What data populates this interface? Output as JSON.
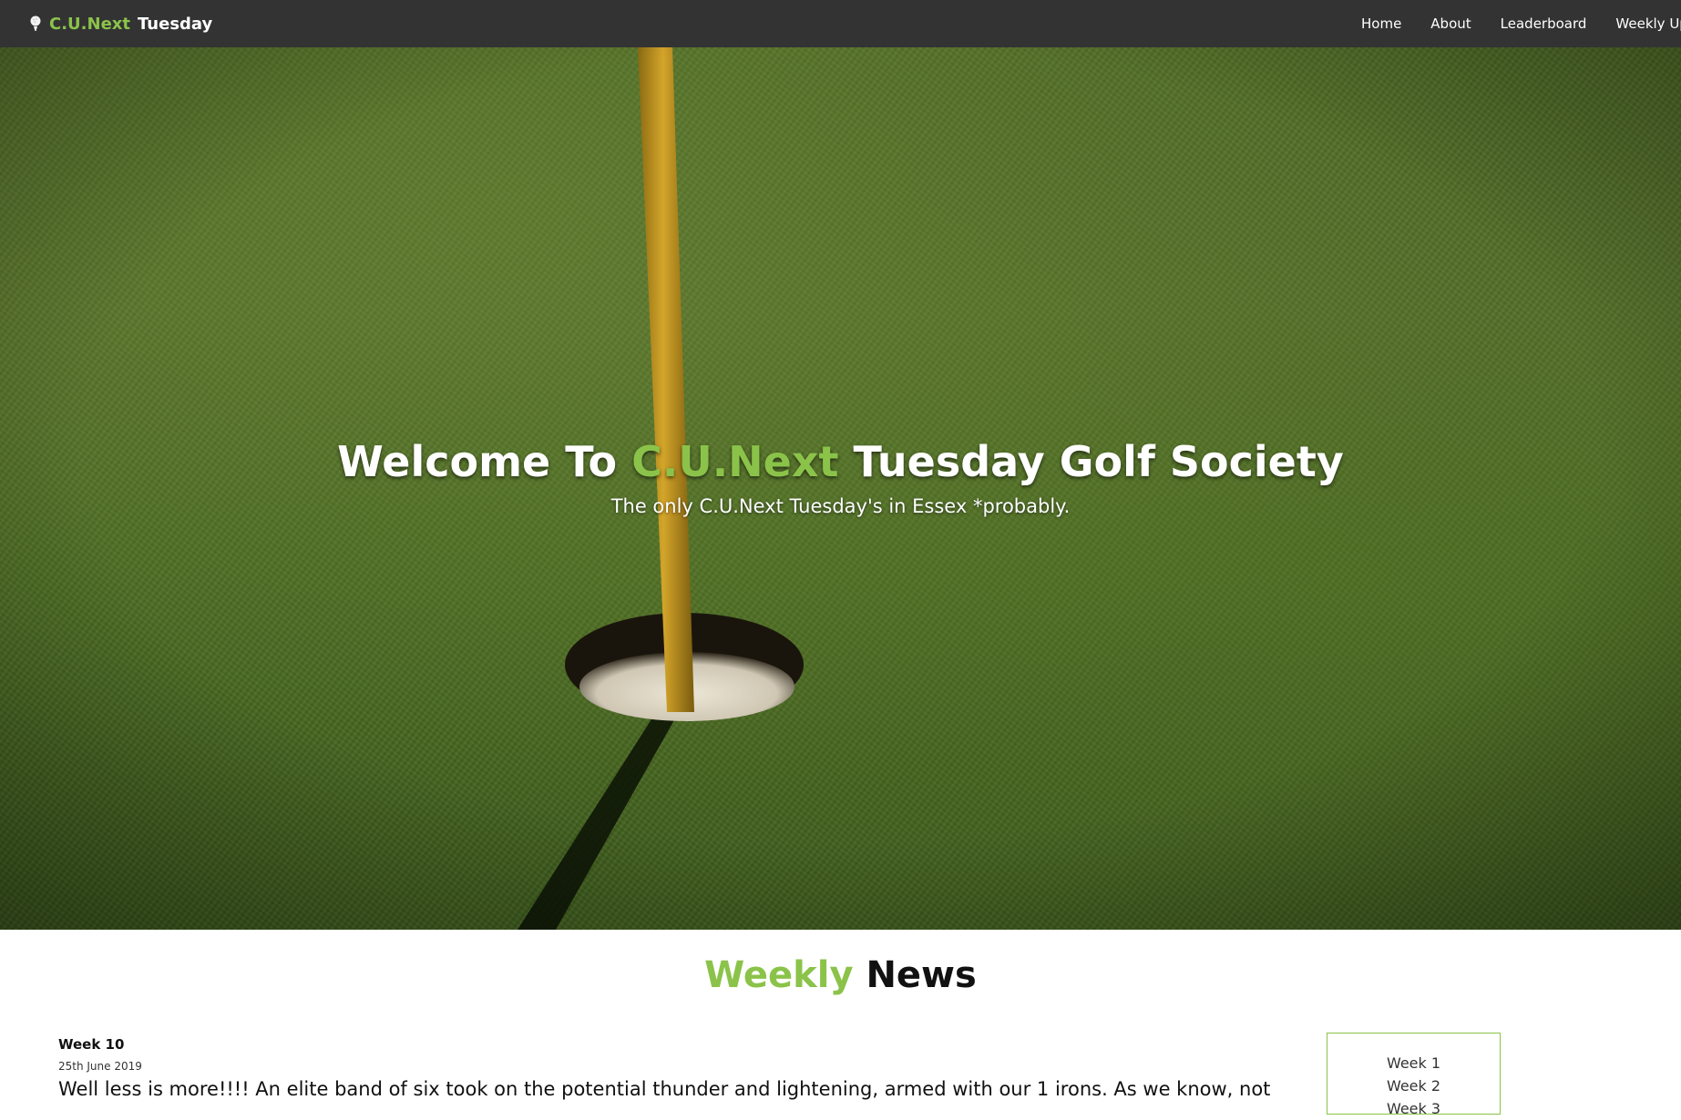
{
  "navbar": {
    "brand_accent": "C.U.Next",
    "brand_plain": "Tuesday",
    "links": [
      "Home",
      "About",
      "Leaderboard",
      "Weekly Upd"
    ]
  },
  "hero": {
    "title_prefix": "Welcome To ",
    "title_accent": "C.U.Next",
    "title_suffix": " Tuesday Golf Society",
    "subtitle": "The only C.U.Next Tuesday's in Essex *probably."
  },
  "news": {
    "heading_accent": "Weekly",
    "heading_plain": " News",
    "article": {
      "title": "Week 10",
      "date": "25th June 2019",
      "body": "Well less is more!!!! An elite band of six took on the potential thunder and lightening, armed with our 1 irons. As we know, not"
    },
    "weeks": [
      "Week 1",
      "Week 2",
      "Week 3"
    ]
  },
  "colors": {
    "accent": "#8bc34a",
    "navbar_bg": "#333333"
  }
}
